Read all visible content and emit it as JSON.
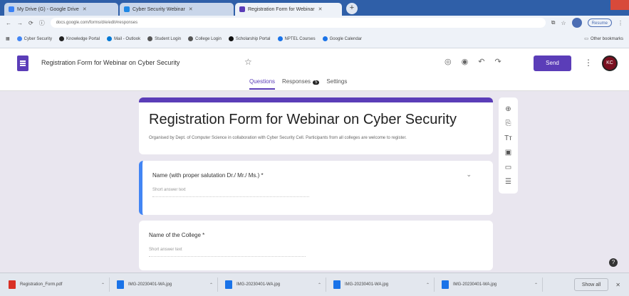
{
  "browser": {
    "tabs": [
      {
        "label": "My Drive (G) - Google Drive",
        "fav_color": "#3b82f6"
      },
      {
        "label": "Cyber Security Webinar",
        "fav_color": "#1e88e5"
      },
      {
        "label": "Registration Form for Webinar",
        "fav_color": "#5b3db8"
      }
    ],
    "url": "docs.google.com/forms/d/e/edit#responses",
    "resume_label": "Resume",
    "bookmarks": [
      "Cyber Security",
      "Knowledge Portal",
      "Mail - Outlook",
      "Student Login",
      "College Login",
      "Scholarship Portal",
      "NPTEL Courses",
      "Google Calendar"
    ],
    "other_bookmarks": "Other bookmarks"
  },
  "forms_toolbar": {
    "form_name": "Registration Form for Webinar on Cyber Security",
    "send_label": "Send",
    "account_initials": "KC",
    "tabs": [
      {
        "label": "Questions",
        "selected": true
      },
      {
        "label": "Responses",
        "selected": false,
        "badge": "5"
      },
      {
        "label": "Settings",
        "selected": false
      }
    ]
  },
  "form": {
    "title": "Registration Form for Webinar on Cyber Security",
    "description": "Organised by Dept. of Computer Science in collaboration with Cyber Security Cell. Participants from all colleges are welcome to register.",
    "questions": [
      {
        "title": "Name (with proper salutation Dr./ Mr./ Ms.) *",
        "placeholder": "Short answer text"
      },
      {
        "title": "Name of the College *",
        "placeholder": "Short answer text"
      }
    ]
  },
  "sidebar_icons": [
    "add-question-icon",
    "import-questions-icon",
    "add-title-icon",
    "add-image-icon",
    "add-video-icon",
    "add-section-icon"
  ],
  "downloads": [
    {
      "name": "Registration_Form.pdf",
      "color": "#d93025"
    },
    {
      "name": "IMG-20230401-WA.jpg",
      "color": "#1a73e8"
    },
    {
      "name": "IMG-20230401-WA.jpg",
      "color": "#1a73e8"
    },
    {
      "name": "IMG-20230401-WA.jpg",
      "color": "#1a73e8"
    },
    {
      "name": "IMG-20230401-WA.jpg",
      "color": "#1a73e8"
    }
  ],
  "show_all_label": "Show all"
}
